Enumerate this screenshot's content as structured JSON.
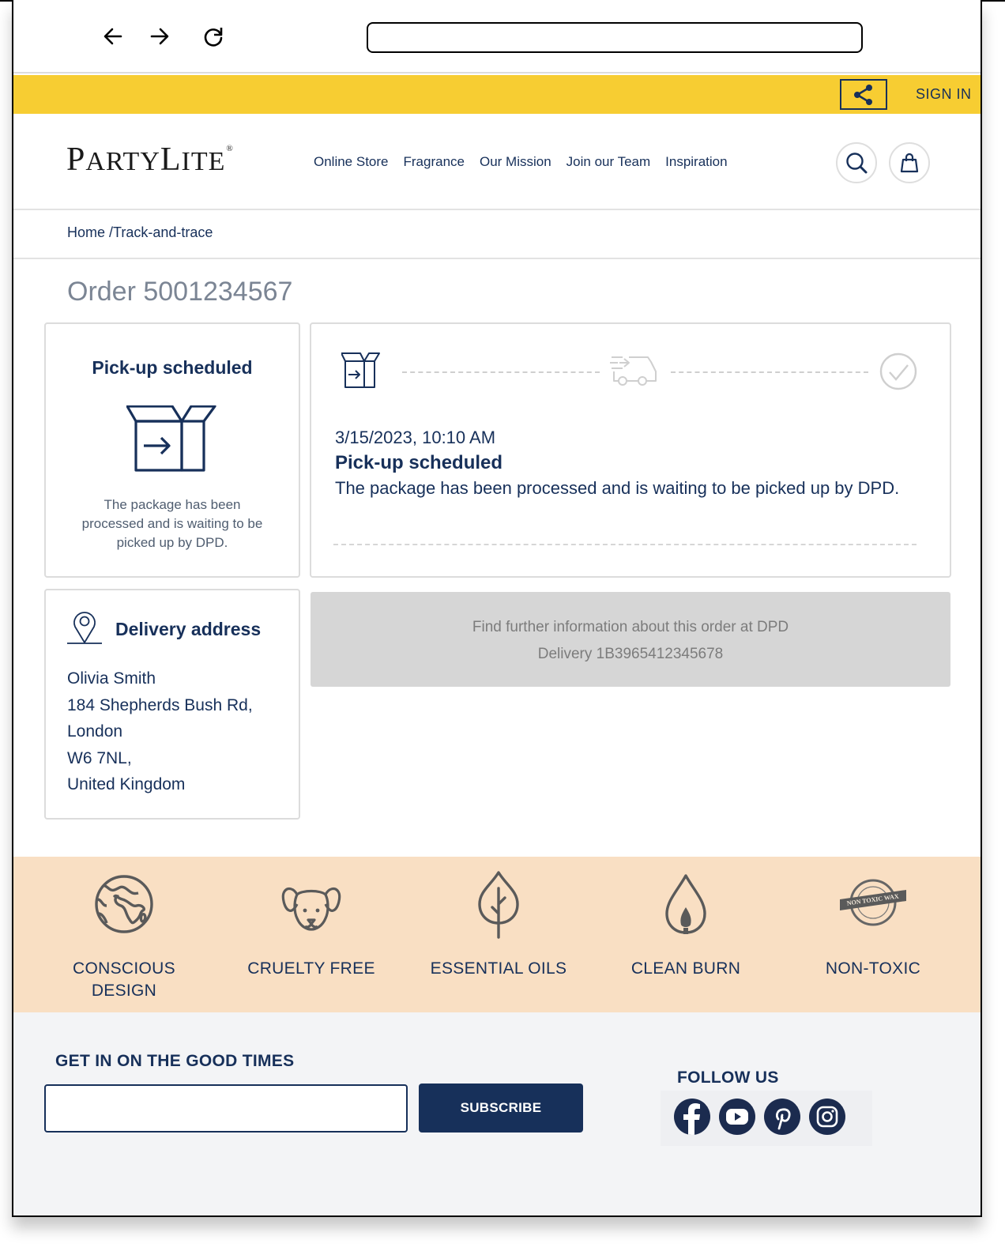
{
  "browser": {
    "back_icon": "arrow-left-icon",
    "forward_icon": "arrow-right-icon",
    "reload_icon": "reload-icon",
    "url": ""
  },
  "topbar": {
    "share_icon": "share-icon",
    "signin_label": "SIGN IN"
  },
  "header": {
    "logo_text": {
      "p": "P",
      "arty": "ARTY",
      "l": "L",
      "ite": "ITE",
      "reg": "®"
    },
    "nav": [
      "Online Store",
      "Fragrance",
      "Our Mission",
      "Join our Team",
      "Inspiration"
    ],
    "search_icon": "search-icon",
    "bag_icon": "shopping-bag-icon"
  },
  "breadcrumb": {
    "home": "Home",
    "separator": "/",
    "current": "Track-and-trace"
  },
  "order": {
    "title": "Order 5001234567"
  },
  "status_card": {
    "title": "Pick-up scheduled",
    "icon": "package-out-icon",
    "description": "The package has been processed and is waiting to be picked up by DPD."
  },
  "timeline": {
    "steps": [
      {
        "name": "pick-up",
        "icon": "package-out-icon",
        "state": "active"
      },
      {
        "name": "in-transit",
        "icon": "delivery-truck-icon",
        "state": "inactive"
      },
      {
        "name": "delivered",
        "icon": "check-circle-icon",
        "state": "inactive"
      }
    ],
    "event": {
      "datetime": "3/15/2023, 10:10 AM",
      "title": "Pick-up scheduled",
      "description": "The package has been processed and is waiting to be picked up by DPD."
    }
  },
  "address": {
    "title": "Delivery address",
    "icon": "location-pin-icon",
    "lines": [
      "Olivia Smith",
      "184 Shepherds Bush Rd,",
      "London",
      "W6 7NL,",
      "United Kingdom"
    ]
  },
  "dpd_info": {
    "line1": "Find further information about this order at DPD",
    "line2": "Delivery 1B3965412345678"
  },
  "values": [
    {
      "icon": "globe-icon",
      "label": "CONSCIOUS DESIGN"
    },
    {
      "icon": "puppy-icon",
      "label": "CRUELTY FREE"
    },
    {
      "icon": "leaf-icon",
      "label": "ESSENTIAL OILS"
    },
    {
      "icon": "flame-icon",
      "label": "CLEAN BURN"
    },
    {
      "icon": "non-toxic-wax-badge-icon",
      "label": "NON-TOXIC",
      "badge_text": "NON TOXIC WAX"
    }
  ],
  "footer": {
    "newsletter_title": "GET IN ON THE GOOD TIMES",
    "email_value": "",
    "email_placeholder": "",
    "subscribe_label": "SUBSCRIBE",
    "follow_title": "FOLLOW US",
    "social": [
      "facebook-icon",
      "youtube-icon",
      "pinterest-icon",
      "instagram-icon"
    ]
  },
  "colors": {
    "brand_navy": "#17305a",
    "topbar_yellow": "#f7cd32",
    "values_peach": "#f9dfc3",
    "footer_grey": "#f3f4f6",
    "inactive_grey": "#cfcfcf"
  }
}
